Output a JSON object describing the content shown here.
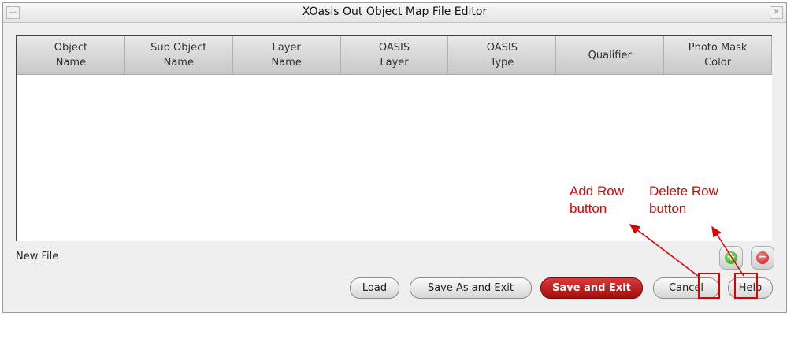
{
  "window": {
    "title": "XOasis Out Object Map File Editor",
    "minimize_glyph": "—",
    "close_glyph": "✕"
  },
  "table": {
    "columns": [
      "Object\nName",
      "Sub Object\nName",
      "Layer\nName",
      "OASIS\nLayer",
      "OASIS\nType",
      "Qualifier",
      "Photo Mask\nColor"
    ],
    "rows": []
  },
  "status": {
    "text": "New File"
  },
  "row_buttons": {
    "add_icon": "plus-circle-green",
    "add_glyph": "+",
    "delete_icon": "minus-circle-red",
    "delete_glyph": "−"
  },
  "buttons": {
    "load": "Load",
    "save_as_and_exit": "Save As and Exit",
    "save_and_exit": "Save and Exit",
    "cancel": "Cancel",
    "help": "Help"
  },
  "annotations": {
    "add_row": "Add  Row\nbutton",
    "delete_row": "Delete Row\nbutton",
    "color": "#e00000"
  }
}
